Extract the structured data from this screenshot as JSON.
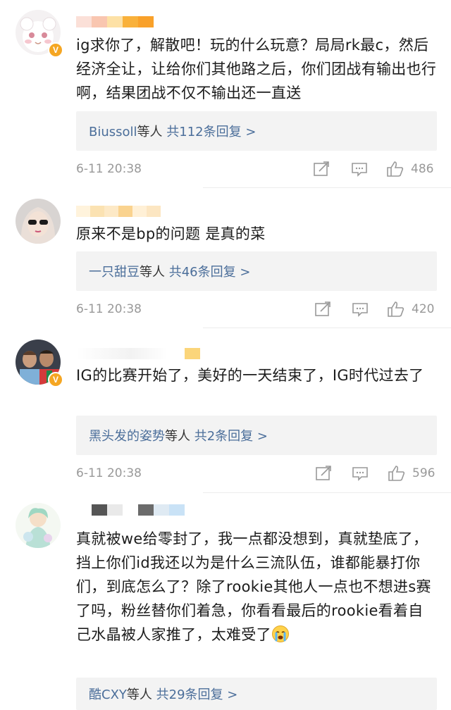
{
  "comments": [
    {
      "text": "ig求你了，解散吧！玩的什么玩意？局局rk最c，然后经济全让，让给你们其他路之后，你们团战有输出也行啊，结果团战不仅不输出还一直送",
      "reply_who": "Biussoll",
      "reply_mid": "等人 ",
      "reply_count": "共112条回复 >",
      "date": "6-11 20:38",
      "likes": "486",
      "verified": "V"
    },
    {
      "text": "原来不是bp的问题 是真的菜",
      "reply_who": "一只甜豆",
      "reply_mid": "等人 ",
      "reply_count": "共46条回复 >",
      "date": "6-11 20:38",
      "likes": "420"
    },
    {
      "text": "IG的比赛开始了，美好的一天结束了，IG时代过去了",
      "reply_who": "黑头发的姿势",
      "reply_mid": "等人 ",
      "reply_count": "共2条回复 >",
      "date": "6-11 20:38",
      "likes": "596",
      "verified": "V"
    },
    {
      "text": "真就被we给零封了，我一点都没想到，真就垫底了，挡上你们id我还以为是什么三流队伍，谁都能暴打你们，到底怎么了？除了rookie其他人一点也不想进s赛了吗，粉丝替你们着急，你看看最后的rookie看着自己水晶被人家推了，太难受了",
      "reply_who": "酷CXY",
      "reply_mid": "等人 ",
      "reply_count": "共29条回复 >"
    }
  ],
  "colors": {
    "link": "#4b6e9a",
    "meta": "#999999",
    "reply_bg": "#f3f3f3",
    "badge": "#f5a623"
  },
  "icons": [
    "share-icon",
    "comment-icon",
    "like-icon",
    "crying-emoji"
  ]
}
